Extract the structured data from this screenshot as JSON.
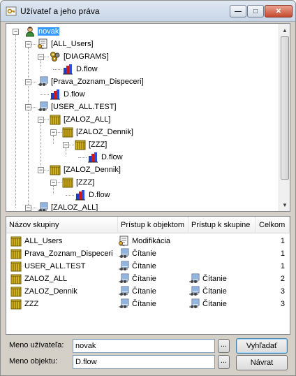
{
  "window": {
    "title": "Užívateľ a jeho práva",
    "minimize_glyph": "—",
    "maximize_glyph": "□",
    "close_glyph": "✕"
  },
  "tree": {
    "nodes": [
      {
        "label": "novak",
        "icon": "user-icon",
        "selected": true
      },
      {
        "label": "[ALL_Users]",
        "icon": "group-modify-icon"
      },
      {
        "label": "[DIAGRAMS]",
        "icon": "diagrams-icon"
      },
      {
        "label": "D.flow",
        "icon": "flow-file-icon"
      },
      {
        "label": "[Prava_Zoznam_Dispeceri]",
        "icon": "group-read-icon"
      },
      {
        "label": "D.flow",
        "icon": "flow-file-icon"
      },
      {
        "label": "[USER_ALL.TEST]",
        "icon": "group-read-icon"
      },
      {
        "label": "[ZALOZ_ALL]",
        "icon": "folder-group-icon"
      },
      {
        "label": "[ZALOZ_Dennik]",
        "icon": "folder-group-icon"
      },
      {
        "label": "[ZZZ]",
        "icon": "folder-group-icon"
      },
      {
        "label": "D.flow",
        "icon": "flow-file-icon"
      },
      {
        "label": "[ZALOZ_Dennik]",
        "icon": "folder-group-icon"
      },
      {
        "label": "[ZZZ]",
        "icon": "folder-group-icon"
      },
      {
        "label": "D.flow",
        "icon": "flow-file-icon"
      },
      {
        "label": "[ZALOZ_ALL]",
        "icon": "group-read-icon"
      }
    ]
  },
  "list": {
    "headers": {
      "group": "Názov skupiny",
      "object_access": "Prístup k objektom",
      "group_access": "Prístup k skupine",
      "total": "Celkom"
    },
    "rows": [
      {
        "group": "ALL_Users",
        "object_access": "Modifikácia",
        "group_access": "",
        "total": "1"
      },
      {
        "group": "Prava_Zoznam_Dispeceri",
        "object_access": "Čítanie",
        "group_access": "",
        "total": "1"
      },
      {
        "group": "USER_ALL.TEST",
        "object_access": "Čítanie",
        "group_access": "",
        "total": "1"
      },
      {
        "group": "ZALOZ_ALL",
        "object_access": "Čítanie",
        "group_access": "Čítanie",
        "total": "2"
      },
      {
        "group": "ZALOZ_Dennik",
        "object_access": "Čítanie",
        "group_access": "Čítanie",
        "total": "3"
      },
      {
        "group": "ZZZ",
        "object_access": "Čítanie",
        "group_access": "Čítanie",
        "total": "3"
      }
    ]
  },
  "form": {
    "user_label": "Meno užívateľa:",
    "user_value": "novak",
    "object_label": "Meno objektu:",
    "object_value": "D.flow",
    "browse_label": "...",
    "search_button": "Vyhľadať",
    "back_button": "Návrat"
  }
}
